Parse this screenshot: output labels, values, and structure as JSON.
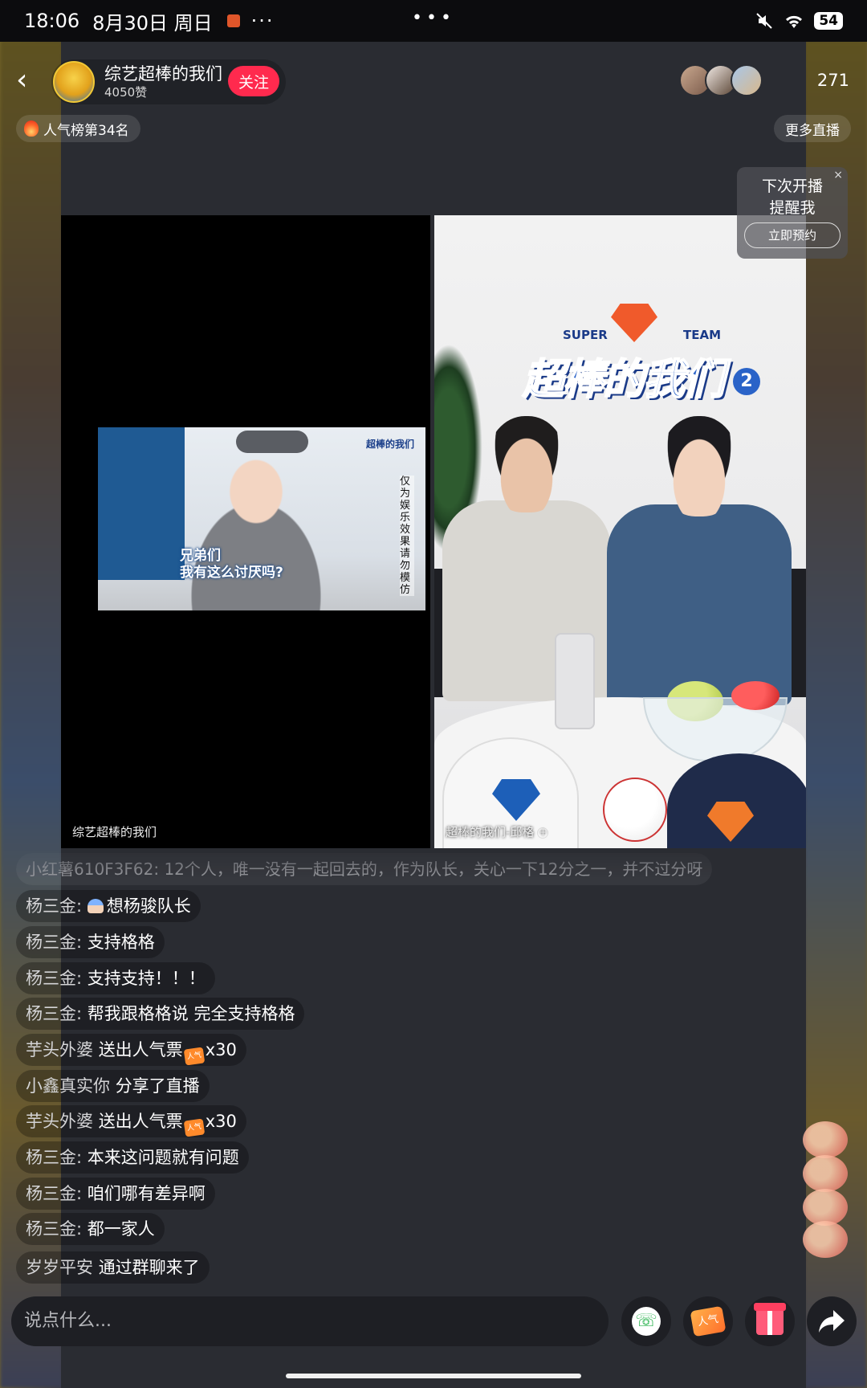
{
  "status_bar": {
    "time": "18:06",
    "date": "8月30日 周日",
    "more": "···",
    "center": "•••",
    "battery": "54"
  },
  "header": {
    "back": "‹",
    "host_name": "综艺超棒的我们",
    "likes": "4050赞",
    "follow": "关注",
    "viewer_count": "271"
  },
  "rank": {
    "label": "人气榜第34名"
  },
  "more_live": "更多直播",
  "reminder": {
    "close": "×",
    "line1": "下次开播",
    "line2": "提醒我",
    "button": "立即预约"
  },
  "video": {
    "left_label": "综艺超棒的我们",
    "right_label": "超棒的我们-邱格",
    "clip_caption_line1": "兄弟们",
    "clip_caption_line2": "我有这么讨厌吗?",
    "clip_side_text": "仅为娱乐效果请勿模仿",
    "clip_logo": "超棒的我们",
    "logo_super": "SUPER",
    "logo_team": "TEAM",
    "logo_title": "超棒的我们",
    "logo_number": "2"
  },
  "comments": {
    "faded": "小红薯610F3F62: 12个人，唯一没有一起回去的，作为队长，关心一下12分之一，并不过分呀",
    "items": [
      {
        "user": "杨三金:",
        "text": "想杨骏队长",
        "emoji": true
      },
      {
        "user": "杨三金:",
        "text": "支持格格"
      },
      {
        "user": "杨三金:",
        "text": "支持支持！！！"
      },
      {
        "user": "杨三金:",
        "text": "帮我跟格格说 完全支持格格"
      },
      {
        "user": "芋头外婆",
        "text": "送出人气票",
        "ticket": true,
        "suffix": "x30"
      },
      {
        "user": "小鑫真实你",
        "text": "分享了直播"
      },
      {
        "user": "芋头外婆",
        "text": "送出人气票",
        "ticket": true,
        "suffix": "x30"
      },
      {
        "user": "杨三金:",
        "text": "本来这问题就有问题"
      },
      {
        "user": "杨三金:",
        "text": "咱们哪有差异啊"
      },
      {
        "user": "杨三金:",
        "text": "都一家人"
      },
      {
        "user": "岁岁平安",
        "text": "通过群聊来了"
      }
    ]
  },
  "bottom_bar": {
    "input_placeholder": "说点什么...",
    "popular_icon_text": "人气"
  },
  "colors": {
    "follow_red": "#ff2a4e",
    "background": "#2a2c32"
  }
}
